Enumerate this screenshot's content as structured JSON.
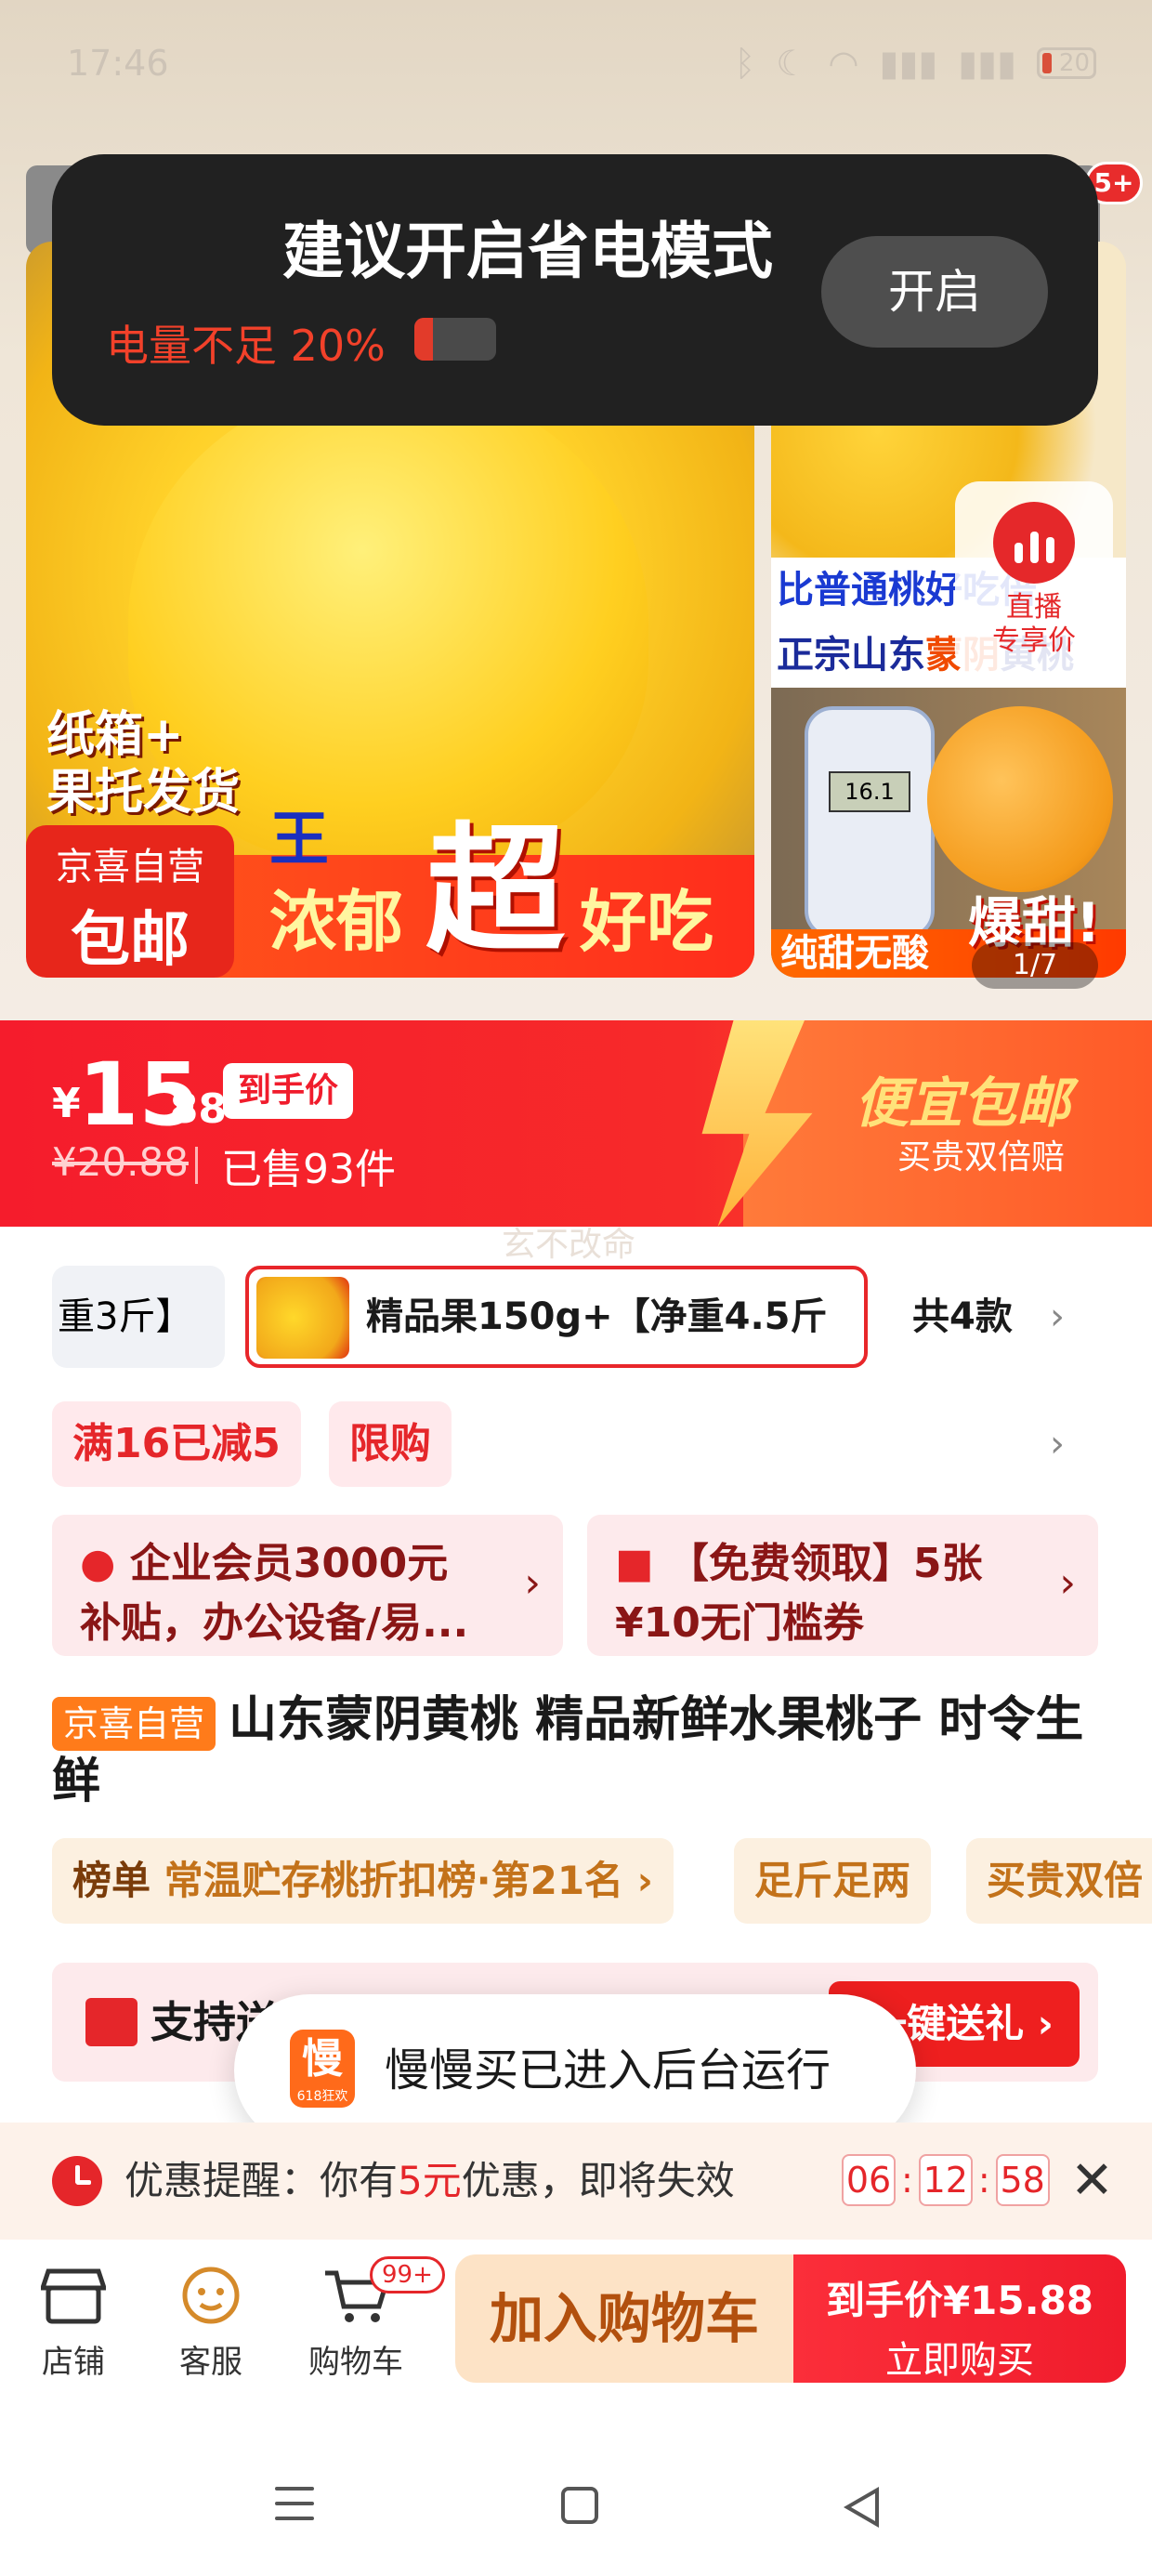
{
  "status_bar": {
    "time": "17:46",
    "battery": "20"
  },
  "hero": {
    "cart_badge": "5+",
    "main_image": {
      "line1": "纸箱+",
      "line2": "果托发货",
      "wang": "王",
      "nongyu": "浓郁",
      "chao": "超",
      "haochi": "好吃"
    },
    "self_tag": {
      "line1": "京喜自营",
      "line2": "包邮"
    },
    "side_image": {
      "line1": "比普通桃好吃倍",
      "line2_a": "正宗山东",
      "line2_b": "蒙阴",
      "line2_c": "黄桃",
      "meter_reading": "16.1",
      "sweet": "纯甜无酸",
      "baotian": "爆甜!"
    },
    "pager": "1/7",
    "live": {
      "line1": "直播",
      "line2": "专享价"
    }
  },
  "power_toast": {
    "title": "建议开启省电模式",
    "subtitle": "电量不足 20%",
    "button": "开启"
  },
  "price": {
    "currency": "¥",
    "integer": "15",
    "decimal": ".88",
    "tag": "到手价",
    "original": "¥20.88",
    "sold": "已售93件",
    "cheap_shipping": "便宜包邮",
    "guarantee": "买贵双倍赔"
  },
  "watermark": "玄不改命",
  "variants": {
    "left_partial": "重3斤】",
    "selected": "精品果150g+【净重4.5斤",
    "count": "共4款",
    "chevron": "›"
  },
  "promos": [
    {
      "label": "满16已减5"
    },
    {
      "label": "限购"
    }
  ],
  "coupons": [
    {
      "line1": "企业会员3000元",
      "line2": "补贴，办公设备/易...",
      "chevron": "›"
    },
    {
      "line1": "【免费领取】5张",
      "line2": "¥10无门槛券",
      "chevron": "›"
    }
  ],
  "product": {
    "tag": "京喜自营",
    "title": "山东蒙阴黄桃 精品新鲜水果桃子 时令生鲜"
  },
  "ranks": [
    {
      "head": "榜单",
      "text": "常温贮存桃折扣榜·第21名 ›"
    },
    {
      "head": "",
      "text": "足斤足两"
    },
    {
      "head": "",
      "text": "买贵双倍"
    }
  ],
  "gift": {
    "text": "支持送",
    "button": "一键送礼 ›"
  },
  "app_toast": {
    "icon_char": "慢",
    "icon_sub": "618狂欢",
    "text": "慢慢买已进入后台运行"
  },
  "reminder": {
    "prefix": "优惠提醒：你有",
    "amount": "5元",
    "suffix": "优惠，即将失效",
    "hours": "06",
    "minutes": "12",
    "seconds": "58",
    "sep": ":",
    "close": "✕"
  },
  "bottom_bar": {
    "store": "店铺",
    "service": "客服",
    "cart": "购物车",
    "cart_badge": "99+",
    "add_cart": "加入购物车",
    "buy_line1": "到手价¥15.88",
    "buy_line2": "立即购买"
  },
  "colors": {
    "brand_red": "#f01c2c",
    "orange": "#ff7b1a",
    "toast_bg": "#212121"
  }
}
